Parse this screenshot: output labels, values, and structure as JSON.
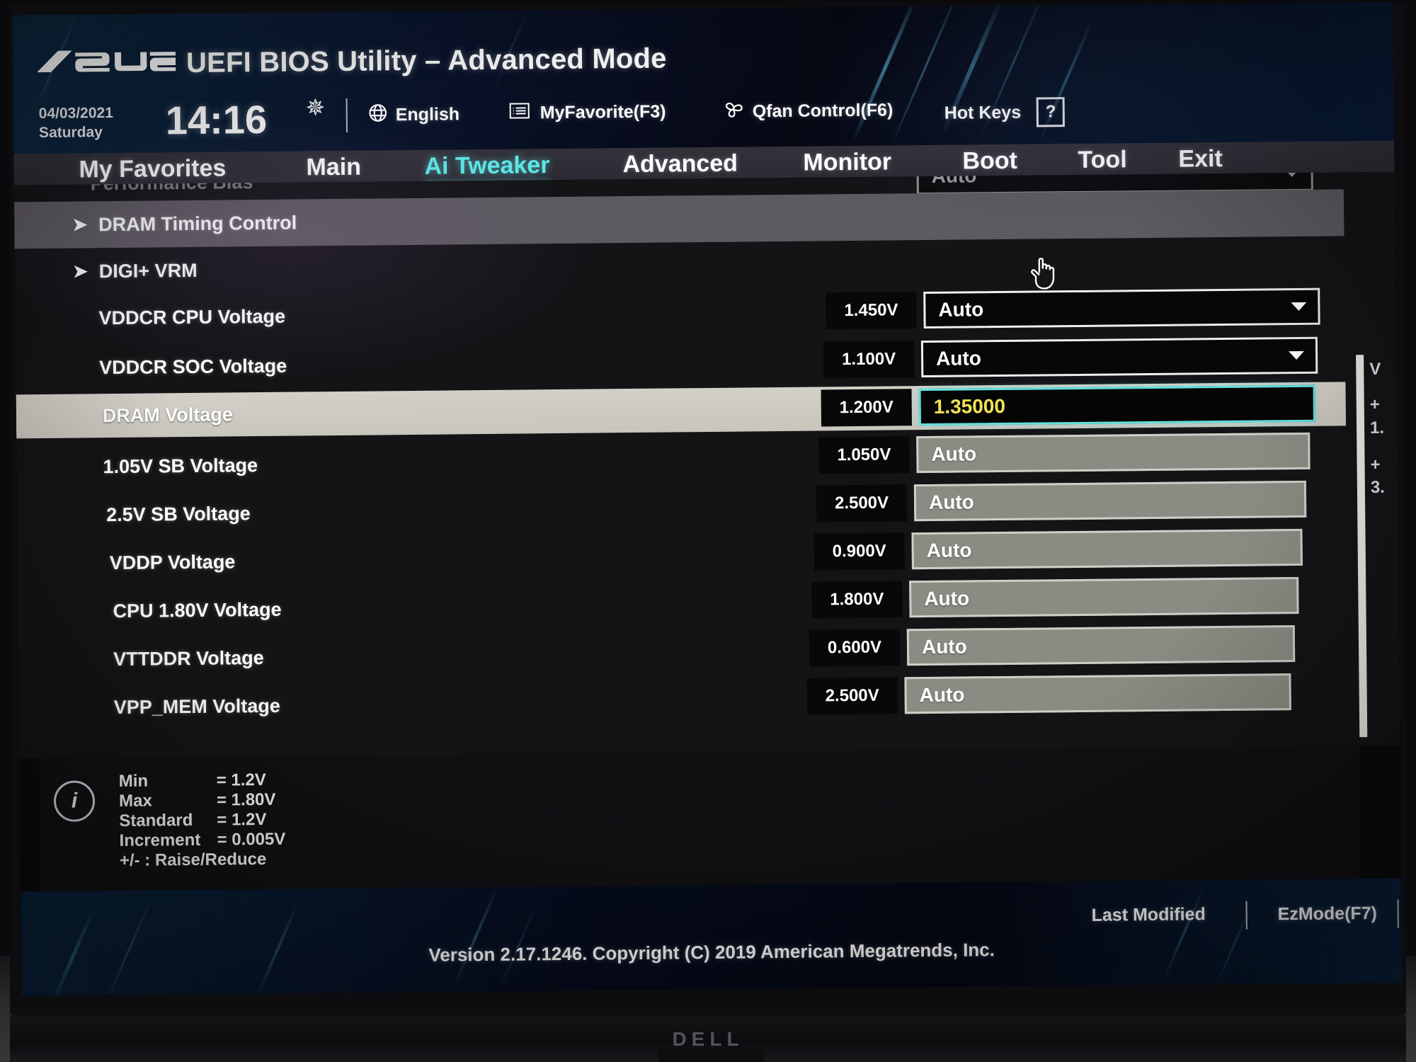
{
  "header": {
    "logo": "ASUS",
    "title": "UEFI BIOS Utility – Advanced Mode",
    "date": "04/03/2021",
    "weekday": "Saturday",
    "time": "14:16",
    "gear_icon": "gear-icon",
    "language": "English",
    "my_favorite": "MyFavorite(F3)",
    "qfan": "Qfan Control(F6)",
    "hot_keys": "Hot Keys",
    "hot_keys_badge": "?"
  },
  "nav": {
    "items": [
      {
        "label": "My Favorites",
        "active": false
      },
      {
        "label": "Main",
        "active": false
      },
      {
        "label": "Ai Tweaker",
        "active": true
      },
      {
        "label": "Advanced",
        "active": false
      },
      {
        "label": "Monitor",
        "active": false
      },
      {
        "label": "Boot",
        "active": false
      },
      {
        "label": "Tool",
        "active": false
      },
      {
        "label": "Exit",
        "active": false
      }
    ]
  },
  "list": {
    "scrolled_off_label": "Performance Bias",
    "scrolled_off_value": "Auto",
    "rows": [
      {
        "label": "DRAM Timing Control",
        "type": "submenu",
        "highlight": "band"
      },
      {
        "label": "DIGI+ VRM",
        "type": "submenu",
        "highlight": "none"
      },
      {
        "label": "VDDCR CPU Voltage",
        "type": "dropdown",
        "spec": "1.450V",
        "value": "Auto",
        "highlight": "none"
      },
      {
        "label": "VDDCR SOC Voltage",
        "type": "dropdown",
        "spec": "1.100V",
        "value": "Auto",
        "highlight": "none"
      },
      {
        "label": "DRAM Voltage",
        "type": "edit",
        "spec": "1.200V",
        "value": "1.35000",
        "highlight": "selected"
      },
      {
        "label": "1.05V SB Voltage",
        "type": "flat",
        "spec": "1.050V",
        "value": "Auto",
        "highlight": "none"
      },
      {
        "label": "2.5V SB Voltage",
        "type": "flat",
        "spec": "2.500V",
        "value": "Auto",
        "highlight": "none"
      },
      {
        "label": "VDDP Voltage",
        "type": "flat",
        "spec": "0.900V",
        "value": "Auto",
        "highlight": "none"
      },
      {
        "label": "CPU 1.80V Voltage",
        "type": "flat",
        "spec": "1.800V",
        "value": "Auto",
        "highlight": "none"
      },
      {
        "label": "VTTDDR Voltage",
        "type": "flat",
        "spec": "0.600V",
        "value": "Auto",
        "highlight": "none"
      },
      {
        "label": "VPP_MEM Voltage",
        "type": "flat",
        "spec": "2.500V",
        "value": "Auto",
        "highlight": "none"
      }
    ],
    "edge_fragments": [
      "V",
      "+",
      "1.",
      "+",
      "3."
    ]
  },
  "info": {
    "icon": "i",
    "rows": [
      {
        "key": "Min",
        "value": "= 1.2V"
      },
      {
        "key": "Max",
        "value": "= 1.80V"
      },
      {
        "key": "Standard",
        "value": "= 1.2V"
      },
      {
        "key": "Increment",
        "value": "= 0.005V"
      }
    ],
    "hint": "+/- : Raise/Reduce"
  },
  "footer": {
    "last_modified": "Last Modified",
    "ez_mode": "EzMode(F7)",
    "version": "Version 2.17.1246. Copyright (C) 2019 American Megatrends, Inc."
  },
  "monitor": {
    "brand": "DELL"
  },
  "colors": {
    "accent_cyan": "#5ce6e6",
    "edit_text_yellow": "#f2e356",
    "highlight_band": "#d3d0c8",
    "submenu_band": "#5d5a60"
  }
}
